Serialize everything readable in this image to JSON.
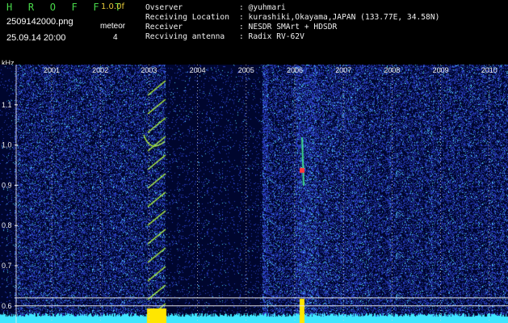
{
  "header": {
    "app_title": "H R O F F T",
    "version": "1.0.0f",
    "file_name": "2509142000.png",
    "datetime": "25.09.14 20:00",
    "meteor_label": "meteor",
    "meteor_count": "4"
  },
  "station": [
    {
      "label": "Ovserver",
      "value": ": @yuhmari"
    },
    {
      "label": "Receiving Location",
      "value": ": kurashiki,Okayama,JAPAN (133.77E, 34.58N)"
    },
    {
      "label": "Receiver",
      "value": ": NESDR SMArt + HDSDR"
    },
    {
      "label": "Recviving antenna",
      "value": ": Radix RV-62V"
    }
  ],
  "chart_data": {
    "type": "heatmap",
    "ylabel": "kHz",
    "time_ticks": [
      "2001",
      "2002",
      "2003",
      "2004",
      "2005",
      "2006",
      "2007",
      "2008",
      "2009",
      "2010"
    ],
    "freq_ticks": [
      1.1,
      1.0,
      0.9,
      0.8,
      0.7,
      0.6
    ],
    "ylim": [
      0.57,
      1.2
    ],
    "colors": {
      "background": "#00062e",
      "noise": "#2a3fc0",
      "hot": "#56d6ff",
      "signal": "#b8ff3a",
      "meteor_core": "#ff3a3a",
      "level_trace": "#3fe6ff",
      "level_peak": "#ffe600"
    }
  }
}
